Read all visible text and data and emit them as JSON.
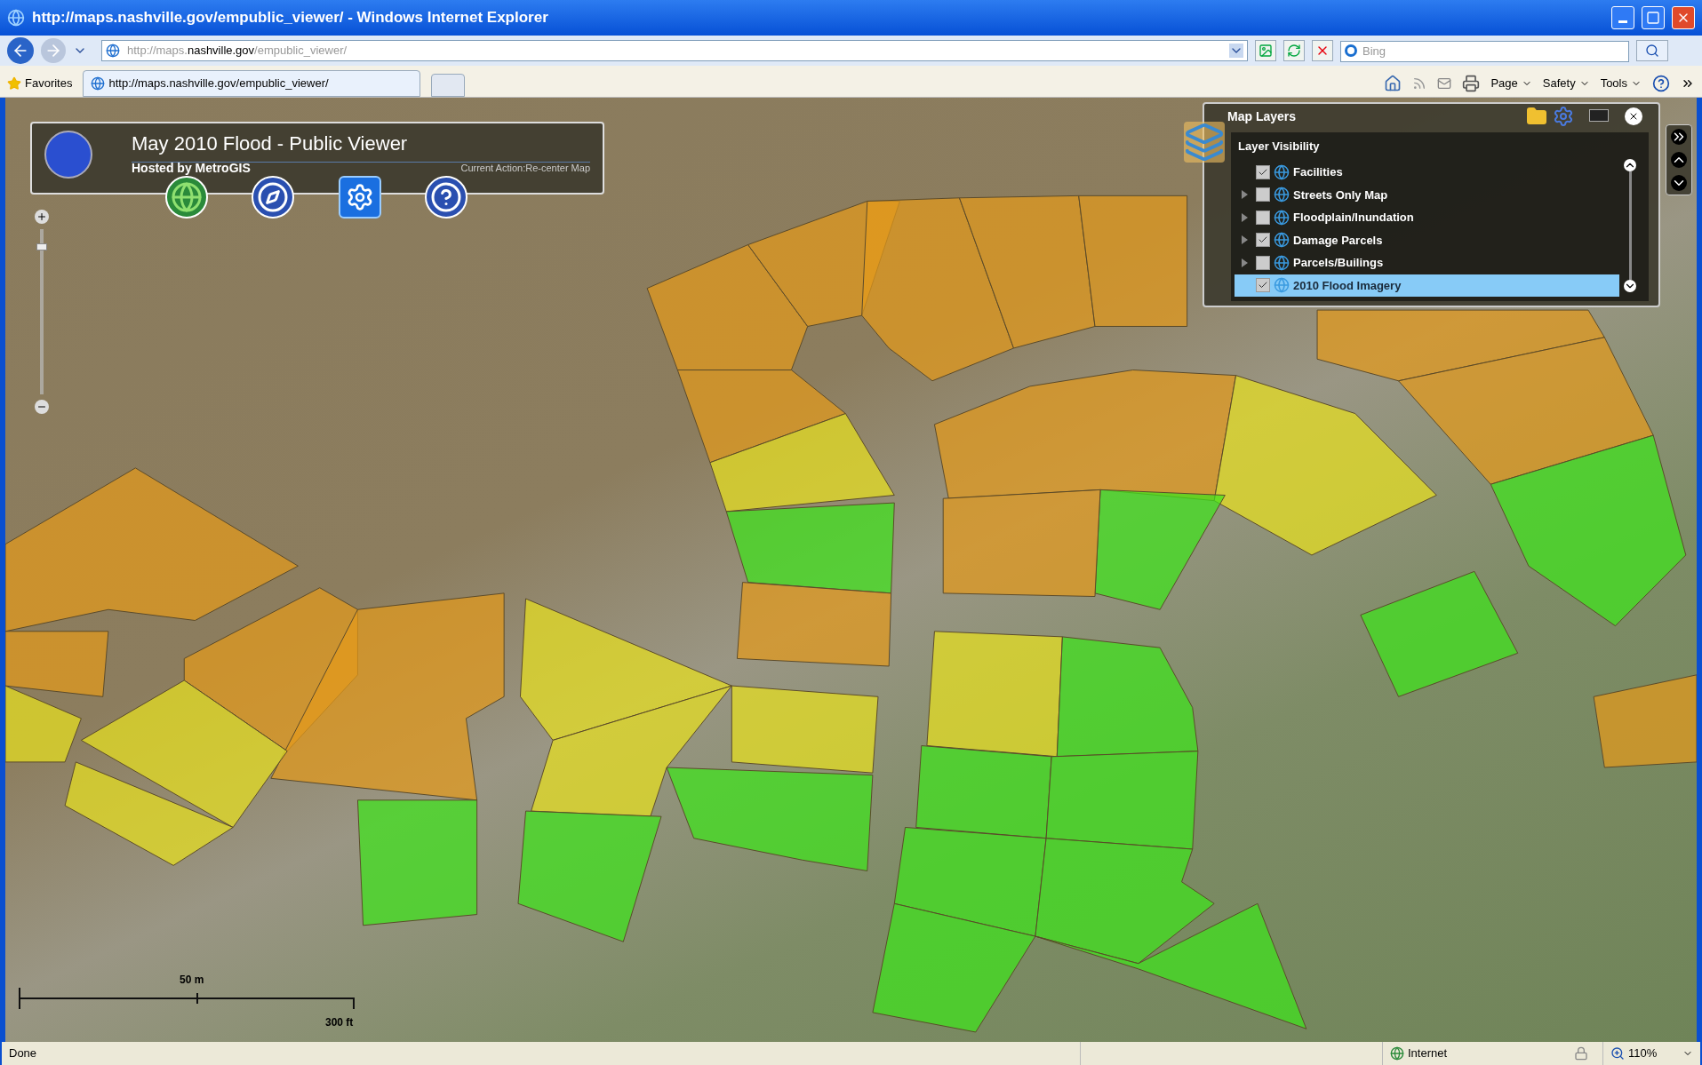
{
  "window": {
    "title": "http://maps.nashville.gov/empublic_viewer/ - Windows Internet Explorer"
  },
  "address": {
    "prefix": "http://maps.",
    "domain": "nashville.gov",
    "path": "/empublic_viewer/"
  },
  "search": {
    "placeholder": "Bing"
  },
  "favorites": {
    "label": "Favorites"
  },
  "tabs": [
    {
      "label": "http://maps.nashville.gov/empublic_viewer/",
      "selected": true
    }
  ],
  "command_bar": [
    "Page",
    "Safety",
    "Tools"
  ],
  "viewer": {
    "title": "May 2010 Flood - Public Viewer",
    "hosted_by": "Hosted by MetroGIS",
    "current_action": "Current Action:Re-center Map"
  },
  "zoom_slider": {
    "level": 0.91
  },
  "map_layers": {
    "title": "Map Layers",
    "section": "Layer Visibility",
    "layers": [
      {
        "label": "Facilities",
        "checked": true,
        "expandable": false,
        "selected": false
      },
      {
        "label": "Streets Only Map",
        "checked": false,
        "expandable": true,
        "selected": false
      },
      {
        "label": "Floodplain/Inundation",
        "checked": false,
        "expandable": true,
        "selected": false
      },
      {
        "label": "Damage Parcels",
        "checked": true,
        "expandable": true,
        "selected": false
      },
      {
        "label": "Parcels/Builings",
        "checked": false,
        "expandable": true,
        "selected": false
      },
      {
        "label": "2010 Flood Imagery",
        "checked": true,
        "expandable": false,
        "selected": true
      }
    ]
  },
  "scale_bar": {
    "metric": "50 m",
    "imperial": "300 ft"
  },
  "status_bar": {
    "text": "Done",
    "zone": "Internet",
    "zoom": "110%"
  }
}
